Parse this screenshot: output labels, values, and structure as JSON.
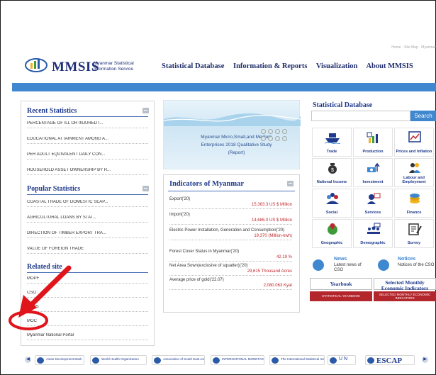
{
  "header": {
    "brand": "MMSIS",
    "brand_sub": "Myanmar Statistical Information Service",
    "top_links": "Home · Site Map · Myanmar",
    "nav": [
      "Statistical Database",
      "Information & Reports",
      "Visualization",
      "About MMSIS"
    ]
  },
  "left": {
    "recent_title": "Recent Statistics",
    "recent_items": [
      "PERCENTAGE OF ILL OR INJURED I...",
      "EDUCATIONAL ATTAINMENT AMONG A...",
      "PER ADULT EQUIVALENT DAILY CON...",
      "HOUSEHOLD ASSET OWNERSHIP BY R..."
    ],
    "popular_title": "Popular Statistics",
    "popular_items": [
      "COASTAL TRADE OF DOMESTIC SEAP...",
      "AGRICULTURAL LOANS BY STAT...",
      "DIRECTION OF TIMBER EXPORT TRA...",
      "VALUE OF FOREIGN TRADE"
    ],
    "related_title": "Related site",
    "related_items": [
      "MOPF",
      "CSO",
      "NSDS",
      "MOC",
      "Myanmar National Portal"
    ]
  },
  "banner": {
    "text": "Myanmar Micro,Small,and Medium Enterprises 2018 Qualitative Study (Report)"
  },
  "indicators": {
    "title": "Indicators of Myanmar",
    "rows": [
      {
        "label": "Export('20)",
        "value": "15,363.3 US $ Million"
      },
      {
        "label": "Import('20)",
        "value": "14,686.0 US $ Million"
      },
      {
        "label": "Electric Power Installation, Generation and Consumption('20)",
        "value": "19,370 (Million-kwh)"
      },
      {
        "label": "Forest Cover Status in Myanmar('20)",
        "value": "42.19 %"
      },
      {
        "label": "Net Area Sown(exclusive of squatter)('20)",
        "value": "29,615 Thousand Acres"
      },
      {
        "label": "Average price of gold('22.07)",
        "value": "2,080.063 Kyat"
      }
    ]
  },
  "database": {
    "title": "Statistical Database",
    "search_label": "Search",
    "categories": [
      {
        "label": "Trade",
        "icon": "ship-icon"
      },
      {
        "label": "Production",
        "icon": "factory-icon"
      },
      {
        "label": "Prices and Inflation",
        "icon": "price-chart-icon"
      },
      {
        "label": "National Income",
        "icon": "money-bag-icon"
      },
      {
        "label": "Investment",
        "icon": "investment-icon"
      },
      {
        "label": "Labour and Employment",
        "icon": "workers-icon"
      },
      {
        "label": "Social",
        "icon": "people-icon"
      },
      {
        "label": "Services",
        "icon": "services-icon"
      },
      {
        "label": "Finance",
        "icon": "coins-icon"
      },
      {
        "label": "Geographic",
        "icon": "globe-pin-icon"
      },
      {
        "label": "Demographic",
        "icon": "population-icon"
      },
      {
        "label": "Survey",
        "icon": "survey-icon"
      }
    ],
    "news_title": "News",
    "news_sub": "Latest news of CSO",
    "notices_title": "Notices",
    "notices_sub": "Notices of the CSO",
    "yearbook_label": "Yearbook",
    "monthly_label": "Selected Monthly Economic Indicators",
    "yearbook_bar": "STATISTICAL YEARBOOK",
    "monthly_bar": "SELECTED MONTHLY ECONOMIC INDICATORS"
  },
  "footer": {
    "partners": [
      "Asian Development Bank",
      "World Health Organization",
      "Association of South East Asian Nations",
      "INTERNATIONAL MONETARY FUND",
      "The International Statistical Institute",
      "U N",
      "ESCAP"
    ]
  },
  "colors": {
    "accent_blue": "#3f87cf",
    "heading_navy": "#1f3a8c",
    "value_red": "#c0282e",
    "annotation_red": "#e0141b"
  }
}
